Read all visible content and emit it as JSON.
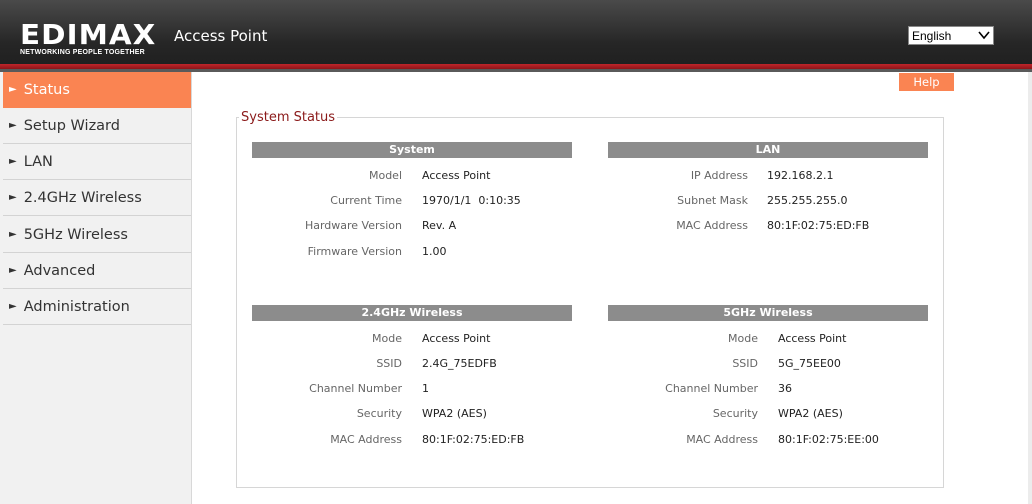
{
  "header": {
    "logo_word": "EDIMAX",
    "logo_tagline": "NETWORKING PEOPLE TOGETHER",
    "app_title": "Access Point",
    "language": "English"
  },
  "sidebar": {
    "items": [
      {
        "label": "Status"
      },
      {
        "label": "Setup Wizard"
      },
      {
        "label": "LAN"
      },
      {
        "label": "2.4GHz Wireless"
      },
      {
        "label": "5GHz Wireless"
      },
      {
        "label": "Advanced"
      },
      {
        "label": "Administration"
      }
    ]
  },
  "help_label": "Help",
  "main": {
    "title": "System Status",
    "system": {
      "heading": "System",
      "rows": [
        {
          "label": "Model",
          "value": "Access Point"
        },
        {
          "label": "Current Time",
          "value": "1970/1/1  0:10:35"
        },
        {
          "label": "Hardware Version",
          "value": "Rev. A"
        },
        {
          "label": "Firmware Version",
          "value": "1.00"
        }
      ]
    },
    "lan": {
      "heading": "LAN",
      "rows": [
        {
          "label": "IP Address",
          "value": "192.168.2.1"
        },
        {
          "label": "Subnet Mask",
          "value": "255.255.255.0"
        },
        {
          "label": "MAC Address",
          "value": "80:1F:02:75:ED:FB"
        }
      ]
    },
    "wireless24": {
      "heading": "2.4GHz  Wireless",
      "rows": [
        {
          "label": "Mode",
          "value": "Access Point"
        },
        {
          "label": "SSID",
          "value": "2.4G_75EDFB"
        },
        {
          "label": "Channel Number",
          "value": "1"
        },
        {
          "label": "Security",
          "value": "WPA2 (AES)"
        },
        {
          "label": "MAC Address",
          "value": "80:1F:02:75:ED:FB"
        }
      ]
    },
    "wireless5": {
      "heading": "5GHz  Wireless",
      "rows": [
        {
          "label": "Mode",
          "value": "Access Point"
        },
        {
          "label": "SSID",
          "value": "5G_75EE00"
        },
        {
          "label": "Channel Number",
          "value": "36"
        },
        {
          "label": "Security",
          "value": "WPA2 (AES)"
        },
        {
          "label": "MAC Address",
          "value": "80:1F:02:75:EE:00"
        }
      ]
    }
  },
  "colors": {
    "accent": "#fa8452",
    "header_red": "#c0262b",
    "section_header": "#8c8c8c",
    "title_red": "#8b1a1a"
  }
}
